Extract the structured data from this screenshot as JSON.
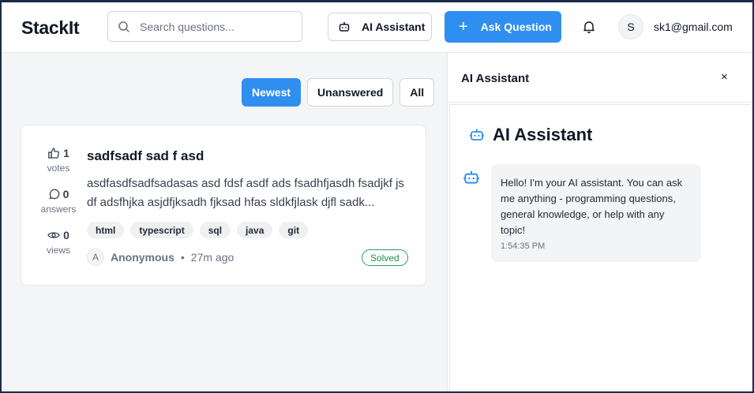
{
  "header": {
    "logo": "StackIt",
    "search_placeholder": "Search questions...",
    "ai_button_label": "AI Assistant",
    "ask_button_label": "Ask Question",
    "user_initial": "S",
    "user_email": "sk1@gmail.com"
  },
  "filters": [
    {
      "label": "Newest",
      "active": true
    },
    {
      "label": "Unanswered",
      "active": false
    },
    {
      "label": "All",
      "active": false
    }
  ],
  "question": {
    "votes": "1",
    "votes_label": "votes",
    "answers": "0",
    "answers_label": "answers",
    "views": "0",
    "views_label": "views",
    "title": "sadfsadf sad f asd",
    "body": "asdfasdfsadfsadasas asd fdsf asdf ads fsadhfjasdh fsadjkf js df adsfhjka asjdfjksadh fjksad hfas sldkfjlask djfl sadk...",
    "tags": [
      "html",
      "typescript",
      "sql",
      "java",
      "git"
    ],
    "author_initial": "A",
    "author": "Anonymous",
    "separator": "•",
    "time": "27m ago",
    "status": "Solved"
  },
  "ai_panel": {
    "title": "AI Assistant",
    "close": "×",
    "heading": "AI Assistant",
    "message": "Hello! I'm your AI assistant. You can ask me anything - programming questions, general knowledge, or help with any topic!",
    "message_time": "1:54:35 PM"
  },
  "colors": {
    "accent": "#2f8ff0",
    "solved": "#22a05a",
    "frame": "#1b2a4a"
  }
}
